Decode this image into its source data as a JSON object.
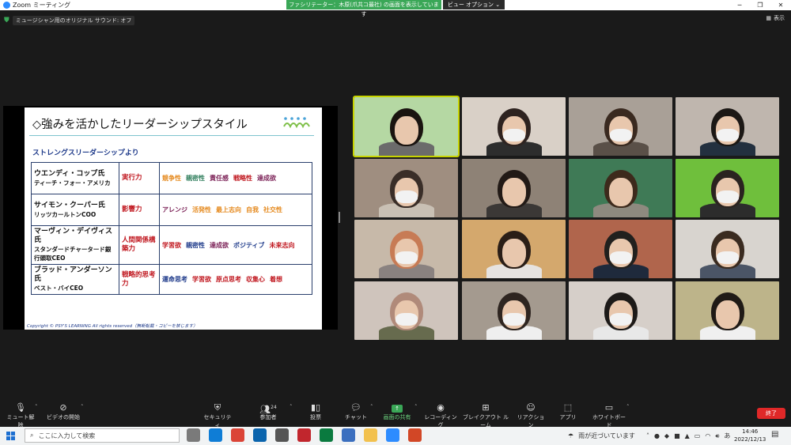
{
  "window": {
    "app_title": "Zoom ミーティング",
    "banner_text": "ファシリテーター：木原(爪共コ最社) の画面を表示しています",
    "view_options": "ビュー オプション",
    "icons": [
      "zoom-logo",
      "minimize-icon",
      "maximize-icon",
      "close-icon"
    ]
  },
  "meeting": {
    "original_sound": "ミュージシャン用のオリジナル サウンド: オフ",
    "show_button": "表示"
  },
  "slide": {
    "title": "◇強みを活かしたリーダーシップスタイル",
    "subtitle": "ストレングスリーダーシップより",
    "rows": [
      {
        "name": "ウエンディ・コップ氏",
        "org": "ティーチ・フォー・アメリカ",
        "skill": "実行力",
        "tags": [
          {
            "t": "競争性",
            "c": "#e58a1f"
          },
          {
            "t": "親密性",
            "c": "#2e7d5b"
          },
          {
            "t": "責任感",
            "c": "#7a1f55"
          },
          {
            "t": "戦略性",
            "c": "#c0171f"
          },
          {
            "t": "達成欲",
            "c": "#7a1f55"
          }
        ]
      },
      {
        "name": "サイモン・クーパー氏",
        "org": "リッツカールトンCOO",
        "skill": "影響力",
        "tags": [
          {
            "t": "アレンジ",
            "c": "#7a1f55"
          },
          {
            "t": "活発性",
            "c": "#e58a1f"
          },
          {
            "t": "最上志向",
            "c": "#e58a1f"
          },
          {
            "t": "自我",
            "c": "#e58a1f"
          },
          {
            "t": "社交性",
            "c": "#e58a1f"
          }
        ]
      },
      {
        "name": "マーヴィン・デイヴィス氏",
        "org": "スタンダードチャータード銀行頭取CEO",
        "skill": "人間関係構築力",
        "tags": [
          {
            "t": "学習欲",
            "c": "#c0171f"
          },
          {
            "t": "親密性",
            "c": "#1e3a8a"
          },
          {
            "t": "達成欲",
            "c": "#7a1f55"
          },
          {
            "t": "ポジティブ",
            "c": "#1e3a8a"
          },
          {
            "t": "未来志向",
            "c": "#c0171f"
          }
        ]
      },
      {
        "name": "ブラッド・アンダーソン氏",
        "org": "ベスト・バイCEO",
        "skill": "戦略的思考力",
        "tags": [
          {
            "t": "運命思考",
            "c": "#1e3a8a"
          },
          {
            "t": "学習欲",
            "c": "#c0171f"
          },
          {
            "t": "原点思考",
            "c": "#c0171f"
          },
          {
            "t": "収集心",
            "c": "#c0171f"
          },
          {
            "t": "着想",
            "c": "#c0171f"
          }
        ]
      }
    ],
    "copyright": "Copyright © PSY'S LEARNING   All rights reserved（無断転載・コピーを禁じます）"
  },
  "gallery": {
    "tiles": [
      {
        "bg": "#b5d8a3",
        "hair": "#1a1410",
        "shirt": "#6b6b6b",
        "mask": false,
        "active": true
      },
      {
        "bg": "#d9d0c7",
        "hair": "#2e2320",
        "shirt": "#2d2d2d",
        "mask": true
      },
      {
        "bg": "#a9a097",
        "hair": "#3a2a20",
        "shirt": "#5a5048",
        "mask": true
      },
      {
        "bg": "#bfb6ae",
        "hair": "#1c1815",
        "shirt": "#23303f",
        "mask": true
      },
      {
        "bg": "#9f8e80",
        "hair": "#3a2e28",
        "shirt": "#c9c0b4",
        "mask": true
      },
      {
        "bg": "#8e8276",
        "hair": "#221a16",
        "shirt": "#3b3836",
        "mask": false
      },
      {
        "bg": "#3f7a56",
        "hair": "#3d2a1c",
        "shirt": "#8e8a7f",
        "mask": false
      },
      {
        "bg": "#6fbf3c",
        "hair": "#2a2320",
        "shirt": "#2c2c2c",
        "mask": true
      },
      {
        "bg": "#c7b9a9",
        "hair": "#c77b55",
        "shirt": "#8a8280",
        "mask": true
      },
      {
        "bg": "#d4a86d",
        "hair": "#2a1e17",
        "shirt": "#e6e3e0",
        "mask": false
      },
      {
        "bg": "#b0654c",
        "hair": "#21201e",
        "shirt": "#1f2a3c",
        "mask": true
      },
      {
        "bg": "#d8d4cf",
        "hair": "#3a2b20",
        "shirt": "#4b5566",
        "mask": true
      },
      {
        "bg": "#cfc4bc",
        "hair": "#b08a7a",
        "shirt": "#676b4e",
        "mask": true
      },
      {
        "bg": "#a49a8f",
        "hair": "#2e2520",
        "shirt": "#efefef",
        "mask": true
      },
      {
        "bg": "#d6cfc9",
        "hair": "#1d1a18",
        "shirt": "#e8e8e8",
        "mask": true
      },
      {
        "bg": "#bdb48a",
        "hair": "#1f1a16",
        "shirt": "#f0f0f0",
        "mask": false
      }
    ]
  },
  "toolbar": {
    "mute": "ミュート解除",
    "video": "ビデオの開始",
    "security": "セキュリティ",
    "participants": "参加者",
    "participants_count": "24",
    "polls": "投票",
    "chat": "チャット",
    "share": "画面の共有",
    "record": "レコーディング",
    "breakout": "ブレイクアウト ルーム",
    "reactions": "リアクション",
    "apps": "アプリ",
    "whiteboard": "ホワイトボード",
    "end": "終了"
  },
  "taskbar": {
    "search_placeholder": "ここに入力して検索",
    "weather": "雨が近づいています",
    "ime": "あ",
    "time": "14:46",
    "date": "2022/12/13",
    "app_colors": [
      "#7a7a7a",
      "#0f7dd6",
      "#db4437",
      "#0a64ad",
      "#555555",
      "#c1262d",
      "#0a7a3f",
      "#3b6fbf",
      "#f2c14e",
      "#2d8cff",
      "#d24726"
    ]
  }
}
